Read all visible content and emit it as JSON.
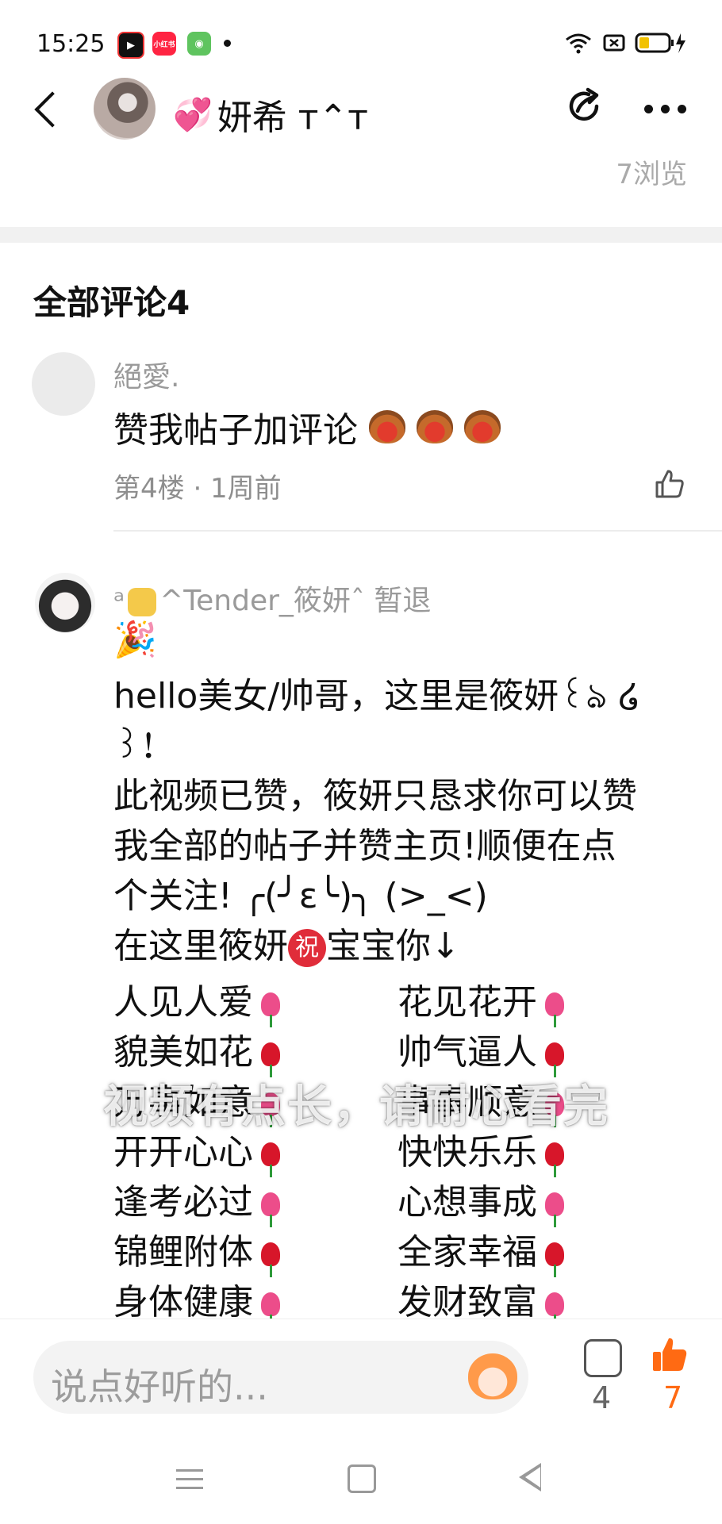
{
  "status_bar": {
    "time": "15:25",
    "app_badge_text": "小红书"
  },
  "header": {
    "title": "妍希 ᴛ⌃ᴛ"
  },
  "views_text": "7浏览",
  "comments_header": "全部评论4",
  "comments": [
    {
      "username": "絕愛.",
      "text": "赞我帖子加评论",
      "meta": "第4楼 · 1周前"
    },
    {
      "username_prefix": "ᵃ",
      "username": "^Tender_筱妍ˆ 暂退",
      "lines": [
        "hello美女/帅哥，这里是筱妍꒰ঌ ໒",
        "꒱！",
        "此视频已赞，筱妍只恳求你可以赞",
        "我全部的帖子并赞主页!顺便在点",
        "个关注! ╭(╯ε╰)╮ (>_<)"
      ],
      "bless_intro_before": "在这里筱妍",
      "zhu": "祝",
      "bless_intro_after": "宝宝你↓",
      "blessings": [
        {
          "a": "人见人爱",
          "b": "花见花开"
        },
        {
          "a": "貌美如花",
          "b": "帅气逼人"
        },
        {
          "a": "万事如意",
          "b": "事事顺意"
        },
        {
          "a": "开开心心",
          "b": "快快乐乐"
        },
        {
          "a": "逢考必过",
          "b": "心想事成"
        },
        {
          "a": "锦鲤附体",
          "b": "全家幸福"
        },
        {
          "a": "身体健康",
          "b": "发财致富"
        }
      ]
    }
  ],
  "overlay_caption": "视频有点长，请耐心看完",
  "bottom_bar": {
    "input_placeholder": "说点好听的...",
    "comment_count": "4",
    "like_count": "7"
  },
  "colors": {
    "accent_orange": "#ff6a13",
    "muted_text": "#9a9a9a"
  }
}
